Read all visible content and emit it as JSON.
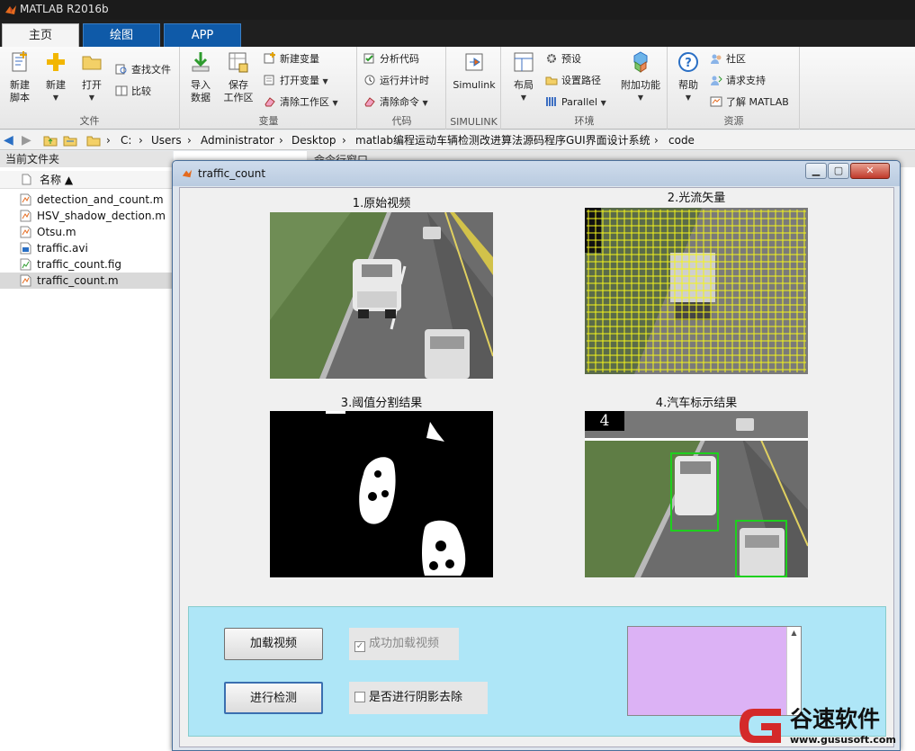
{
  "app": {
    "title": "MATLAB R2016b"
  },
  "tabs": [
    {
      "label": "主页",
      "active": true
    },
    {
      "label": "绘图",
      "active": false
    },
    {
      "label": "APP",
      "active": false
    }
  ],
  "ribbon": {
    "file": {
      "label": "文件",
      "new_script": "新建\n脚本",
      "new": "新建",
      "open": "打开",
      "find_files": "查找文件",
      "compare": "比较"
    },
    "variable": {
      "label": "变量",
      "import_data": "导入\n数据",
      "save_workspace": "保存\n工作区",
      "new_variable": "新建变量",
      "open_variable": "打开变量",
      "clear_workspace": "清除工作区"
    },
    "code": {
      "label": "代码",
      "analyze_code": "分析代码",
      "run_and_time": "运行并计时",
      "clear_commands": "清除命令"
    },
    "simulink": {
      "label": "SIMULINK",
      "button": "Simulink"
    },
    "environment": {
      "label": "环境",
      "layout": "布局",
      "preferences": "预设",
      "set_path": "设置路径",
      "parallel": "Parallel",
      "addons": "附加功能"
    },
    "resources": {
      "label": "资源",
      "help": "帮助",
      "community": "社区",
      "request_support": "请求支持",
      "learn_matlab": "了解 MATLAB"
    }
  },
  "address": {
    "crumbs": [
      "C:",
      "Users",
      "Administrator",
      "Desktop",
      "matlab编程运动车辆检测改进算法源码程序GUI界面设计系统",
      "code"
    ]
  },
  "file_panel": {
    "title": "当前文件夹",
    "col_name": "名称 ▲",
    "files": [
      {
        "name": "detection_and_count.m",
        "type": "m"
      },
      {
        "name": "HSV_shadow_dection.m",
        "type": "m"
      },
      {
        "name": "Otsu.m",
        "type": "m"
      },
      {
        "name": "traffic.avi",
        "type": "avi"
      },
      {
        "name": "traffic_count.fig",
        "type": "fig"
      },
      {
        "name": "traffic_count.m",
        "type": "m",
        "selected": true
      }
    ]
  },
  "command_window": {
    "title": "命令行窗口"
  },
  "figure": {
    "title": "traffic_count",
    "axes": [
      {
        "title": "1.原始视频"
      },
      {
        "title": "2.光流矢量"
      },
      {
        "title": "3.阈值分割结果"
      },
      {
        "title": "4.汽车标示结果",
        "count": "4"
      }
    ],
    "controls": {
      "load_video": "加载视频",
      "detect": "进行检测",
      "load_success": "成功加载视频",
      "load_success_checked": true,
      "shadow_removal": "是否进行阴影去除",
      "shadow_removal_checked": false
    }
  },
  "watermark": {
    "brand": "谷速软件",
    "url": "www.gususoft.com"
  },
  "colors": {
    "ribbon_tab": "#0f5aa8",
    "panel_bg": "#aee6f7",
    "listbox_bg": "#dcb2f5",
    "flow_yellow": "#f5f51a",
    "box_green": "#1ed01e"
  }
}
